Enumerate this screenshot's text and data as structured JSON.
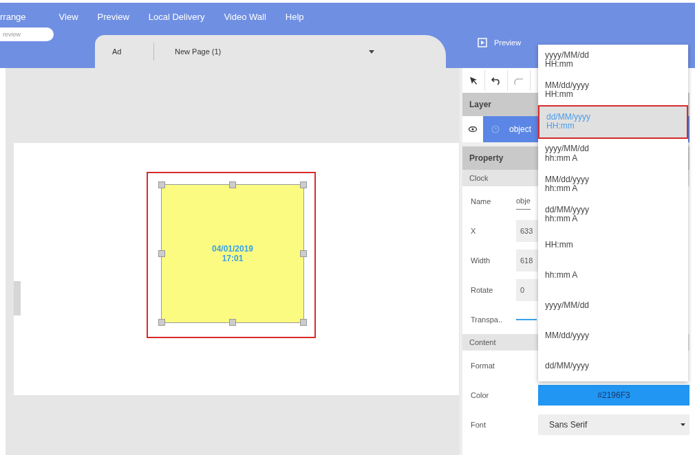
{
  "menu_bar": {
    "items": [
      "rrange",
      "View",
      "Preview",
      "Local Delivery",
      "Video Wall",
      "Help"
    ]
  },
  "toolbar": {
    "search": {
      "placeholder": "review"
    },
    "tab_label": "Ad",
    "page_select": {
      "value": "New Page (1)"
    },
    "preview_button": "Preview"
  },
  "canvas": {
    "clock": {
      "date": "04/01/2019",
      "time": "17:01"
    }
  },
  "layer_panel": {
    "title": "Layer",
    "items": [
      {
        "label": "object",
        "selected": true
      }
    ]
  },
  "property_panel": {
    "title": "Property",
    "sections": [
      {
        "title": "Clock",
        "rows": [
          {
            "kind": "text",
            "label": "Name",
            "value": "obje"
          },
          {
            "kind": "box",
            "label": "X",
            "value": "633"
          },
          {
            "kind": "box",
            "label": "Width",
            "value": "618"
          },
          {
            "kind": "box",
            "label": "Rotate",
            "value": "0"
          },
          {
            "kind": "slider",
            "label": "Transpa.."
          }
        ]
      },
      {
        "title": "Content",
        "rows": [
          {
            "kind": "empty",
            "label": "Format"
          },
          {
            "kind": "color",
            "label": "Color",
            "value": "#2196F3"
          },
          {
            "kind": "select",
            "label": "Font",
            "value": "Sans Serif"
          }
        ]
      }
    ]
  },
  "format_dropdown": {
    "options": [
      {
        "label": "yyyy/MM/dd\nHH:mm",
        "selected": false
      },
      {
        "label": "MM/dd/yyyy\nHH:mm",
        "selected": false
      },
      {
        "label": "dd/MM/yyyy\nHH:mm",
        "selected": true
      },
      {
        "label": "yyyy/MM/dd\nhh:mm A",
        "selected": false
      },
      {
        "label": "MM/dd/yyyy\nhh:mm A",
        "selected": false
      },
      {
        "label": "dd/MM/yyyy\nhh:mm A",
        "selected": false
      },
      {
        "label": "HH:mm",
        "selected": false
      },
      {
        "label": "hh:mm A",
        "selected": false
      },
      {
        "label": "yyyy/MM/dd",
        "selected": false
      },
      {
        "label": "MM/dd/yyyy",
        "selected": false
      },
      {
        "label": "dd/MM/yyyy",
        "selected": false
      }
    ]
  }
}
